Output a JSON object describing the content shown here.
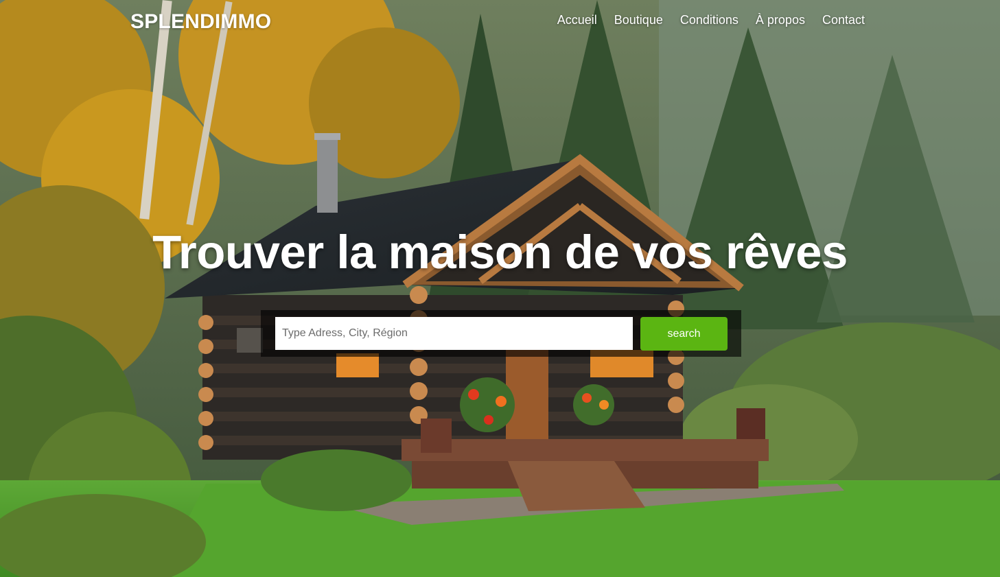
{
  "brand": {
    "name": "SPLENDIMMO"
  },
  "nav": {
    "items": [
      {
        "label": "Accueil"
      },
      {
        "label": "Boutique"
      },
      {
        "label": "Conditions"
      },
      {
        "label": "À propos"
      },
      {
        "label": "Contact"
      }
    ]
  },
  "hero": {
    "headline": "Trouver la maison de vos rêves",
    "background_icon": "log-cabin-in-forest-photo"
  },
  "search": {
    "placeholder": "Type Adress, City, Région",
    "value": "",
    "button_label": "search"
  },
  "colors": {
    "accent": "#5bb512",
    "text": "#ffffff",
    "panel": "rgba(0,0,0,0.62)"
  }
}
